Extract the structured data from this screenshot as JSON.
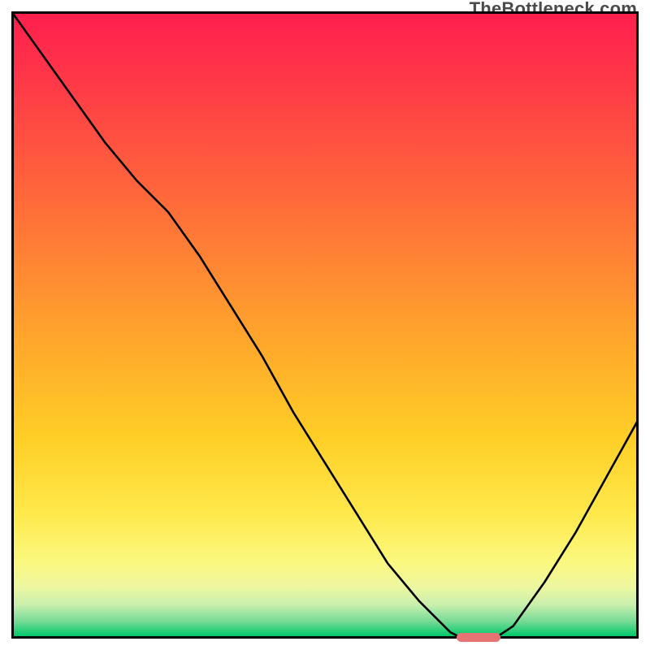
{
  "watermark": "TheBottleneck.com",
  "chart_data": {
    "type": "line",
    "title": "",
    "xlabel": "",
    "ylabel": "",
    "xlim": [
      0,
      100
    ],
    "ylim": [
      0,
      100
    ],
    "grid": false,
    "legend": false,
    "background": {
      "gradient_stops": [
        {
          "pos": 0,
          "color": "#ff1f4e"
        },
        {
          "pos": 10,
          "color": "#ff3648"
        },
        {
          "pos": 30,
          "color": "#ff6a3a"
        },
        {
          "pos": 50,
          "color": "#ffa02d"
        },
        {
          "pos": 68,
          "color": "#ffce26"
        },
        {
          "pos": 80,
          "color": "#ffe84a"
        },
        {
          "pos": 88,
          "color": "#fbf87e"
        },
        {
          "pos": 92,
          "color": "#eef7a0"
        },
        {
          "pos": 95,
          "color": "#c8efad"
        },
        {
          "pos": 97.5,
          "color": "#7bdc98"
        },
        {
          "pos": 100,
          "color": "#00c86a"
        }
      ]
    },
    "series": [
      {
        "name": "bottleneck-curve",
        "x": [
          0,
          5,
          10,
          15,
          20,
          25,
          30,
          35,
          40,
          45,
          50,
          55,
          60,
          65,
          70,
          72,
          77,
          80,
          85,
          90,
          95,
          100
        ],
        "y": [
          100,
          93,
          86,
          79,
          73,
          68,
          61,
          53,
          45,
          36,
          28,
          20,
          12,
          6,
          1,
          0,
          0,
          2,
          9,
          17,
          26,
          35
        ]
      }
    ],
    "annotations": [
      {
        "name": "optimal-band",
        "x_range": [
          71,
          78
        ],
        "y": 0.3,
        "color": "#e57373",
        "shape": "pill"
      }
    ]
  }
}
